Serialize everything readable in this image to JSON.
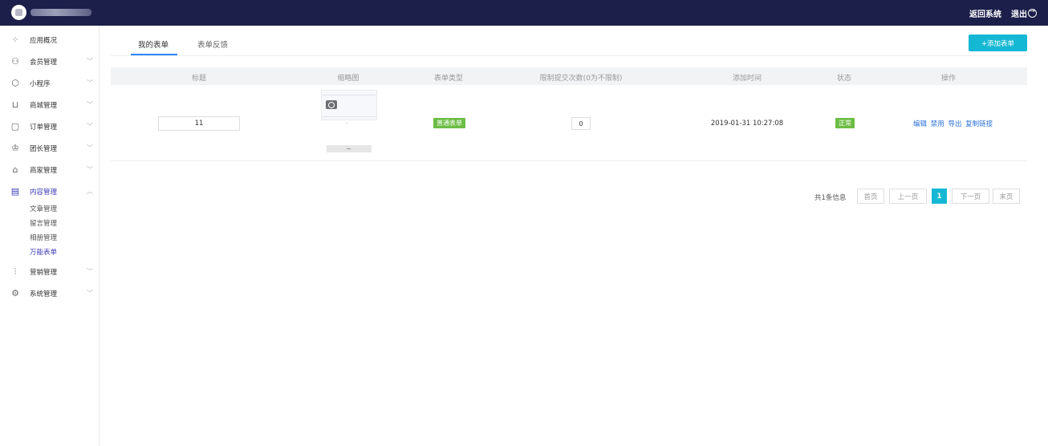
{
  "header": {
    "return_label": "返回系统",
    "logout_label": "退出"
  },
  "sidebar": {
    "items": [
      {
        "label": "应用概况",
        "icon": "grid-icon"
      },
      {
        "label": "会员管理",
        "icon": "users-icon"
      },
      {
        "label": "小程序",
        "icon": "mini-program-icon"
      },
      {
        "label": "商城管理",
        "icon": "cart-icon"
      },
      {
        "label": "订单管理",
        "icon": "order-icon"
      },
      {
        "label": "团长管理",
        "icon": "crown-icon"
      },
      {
        "label": "商家管理",
        "icon": "store-icon"
      },
      {
        "label": "内容管理",
        "icon": "document-icon"
      },
      {
        "label": "营销管理",
        "icon": "chart-icon"
      },
      {
        "label": "系统管理",
        "icon": "settings-icon"
      }
    ],
    "content_sub_items": [
      "文章管理",
      "留言管理",
      "相册管理",
      "万能表单"
    ],
    "active_sub_item": "万能表单"
  },
  "tabs": [
    {
      "label": "我的表单",
      "active": true
    },
    {
      "label": "表单反馈",
      "active": false
    }
  ],
  "add_button": "+添加表单",
  "table": {
    "columns": [
      "标题",
      "缩略图",
      "表单类型",
      "限制提交次数(0为不限制)",
      "添加时间",
      "状态",
      "操作"
    ],
    "rows": [
      {
        "title": "11",
        "form_type": "普通表单",
        "submit_limit": "0",
        "added_time": "2019-01-31 10:27:08",
        "status": "正常",
        "actions": [
          "编辑",
          "禁用",
          "导出",
          "复制链接"
        ]
      }
    ]
  },
  "pagination": {
    "total_text": "共1条信息",
    "first": "首页",
    "prev": "上一页",
    "current": "1",
    "next": "下一页",
    "last": "末页"
  },
  "colors": {
    "topbar": "#1c1f4a",
    "accent": "#15b8d4",
    "active_nav": "#3d3ab8",
    "badge_green": "#6cbd45",
    "link": "#2a72d8"
  }
}
